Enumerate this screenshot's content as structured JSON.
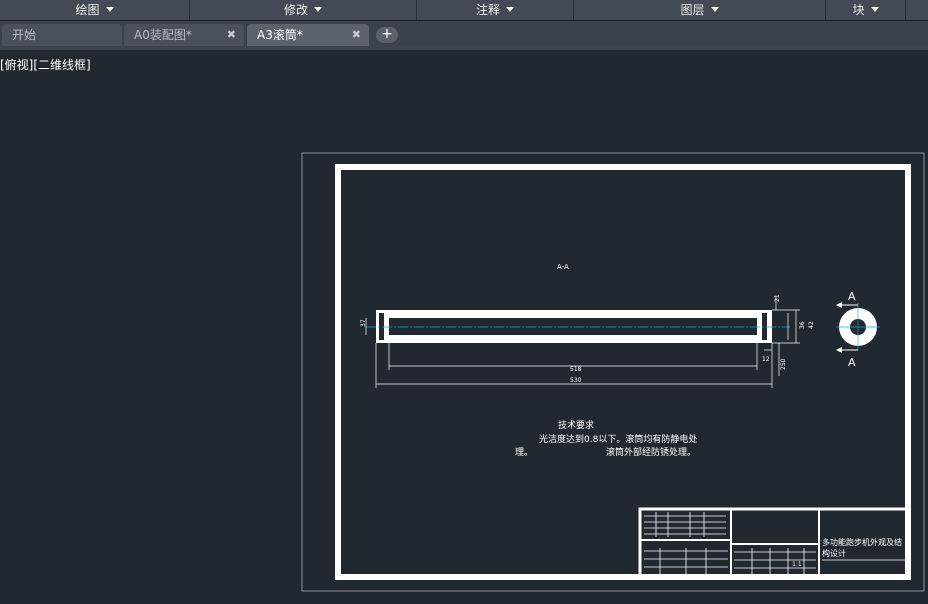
{
  "ribbon": {
    "panels": [
      {
        "label": "绘图"
      },
      {
        "label": "修改"
      },
      {
        "label": "注释"
      },
      {
        "label": "图层"
      },
      {
        "label": "块"
      }
    ]
  },
  "tabs": [
    {
      "label": "开始"
    },
    {
      "label": "A0装配图*"
    },
    {
      "label": "A3滚筒*"
    }
  ],
  "tab_close_glyph": "✖",
  "add_tab_glyph": "+",
  "viewport_label": "[俯视][二维线框]",
  "drawing": {
    "section_title": "A-A",
    "section_marks": [
      "A",
      "A"
    ],
    "dimensions": {
      "inner_length": "518",
      "outer_length": "530",
      "left_dia": "37",
      "right_dia": "42",
      "right_inner": "36",
      "top_small": "21",
      "bottom_small": "12",
      "bottom_right": "250"
    },
    "notes": {
      "heading": "技术要求",
      "line1": "光洁度达到0.8以下。滚筒均有防静电处",
      "line2a": "理。",
      "line2b": "滚筒外部经防锈处理。"
    },
    "title_block": {
      "title_line1": "多功能跑步机外观及结",
      "title_line2": "构设计",
      "scale": "1:1"
    }
  },
  "colors": {
    "background": "#212830",
    "drawing_lines": "#ffffff",
    "centerline": "#00b4d8",
    "ribbon": "#434a55"
  }
}
